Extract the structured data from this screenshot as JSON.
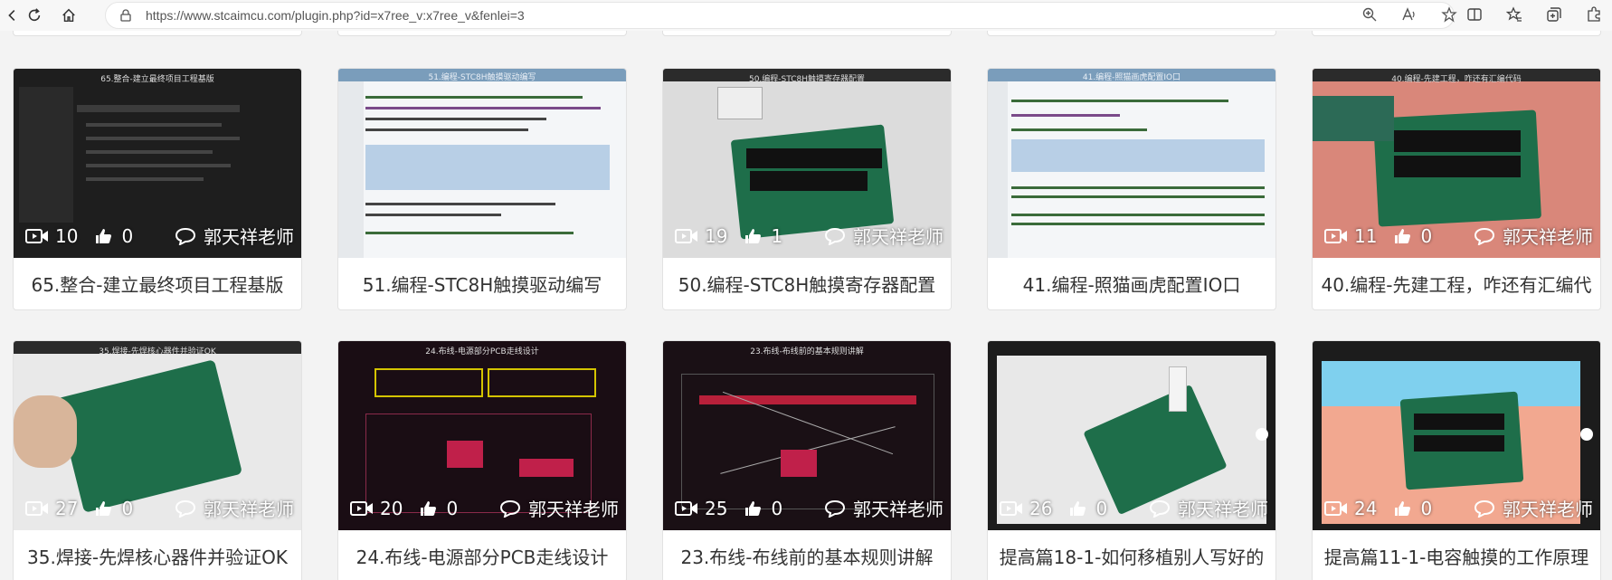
{
  "browser": {
    "url": "https://www.stcaimcu.com/plugin.php?id=x7ree_v:x7ree_v&fenlei=3"
  },
  "icons": {
    "play": "video-camera-icon",
    "like": "thumbs-up-icon",
    "comment": "comment-icon"
  },
  "cards": [
    {
      "views": "10",
      "likes": "0",
      "author": "郭天祥老师",
      "title": "65.整合-建立最终项目工程基版",
      "thumb_title": "65.整合-建立最终项目工程基版"
    },
    {
      "views": "",
      "likes": "",
      "author": "",
      "title": "51.编程-STC8H触摸驱动编写",
      "thumb_title": "51.编程-STC8H触摸驱动编写"
    },
    {
      "views": "19",
      "likes": "1",
      "author": "郭天祥老师",
      "title": "50.编程-STC8H触摸寄存器配置",
      "thumb_title": "50.编程-STC8H触摸寄存器配置"
    },
    {
      "views": "",
      "likes": "",
      "author": "",
      "title": "41.编程-照猫画虎配置IO口",
      "thumb_title": "41.编程-照猫画虎配置IO口"
    },
    {
      "views": "11",
      "likes": "0",
      "author": "郭天祥老师",
      "title": "40.编程-先建工程，咋还有汇编代",
      "thumb_title": "40.编程-先建工程，咋还有汇编代码"
    },
    {
      "views": "27",
      "likes": "0",
      "author": "郭天祥老师",
      "title": "35.焊接-先焊核心器件并验证OK",
      "thumb_title": "35.焊接-先焊核心器件并验证OK"
    },
    {
      "views": "20",
      "likes": "0",
      "author": "郭天祥老师",
      "title": "24.布线-电源部分PCB走线设计",
      "thumb_title": "24.布线-电源部分PCB走线设计"
    },
    {
      "views": "25",
      "likes": "0",
      "author": "郭天祥老师",
      "title": "23.布线-布线前的基本规则讲解",
      "thumb_title": "23.布线-布线前的基本规则讲解"
    },
    {
      "views": "26",
      "likes": "0",
      "author": "郭天祥老师",
      "title": "提高篇18-1-如何移植别人写好的",
      "thumb_title": ""
    },
    {
      "views": "24",
      "likes": "0",
      "author": "郭天祥老师",
      "title": "提高篇11-1-电容触摸的工作原理",
      "thumb_title": ""
    }
  ]
}
